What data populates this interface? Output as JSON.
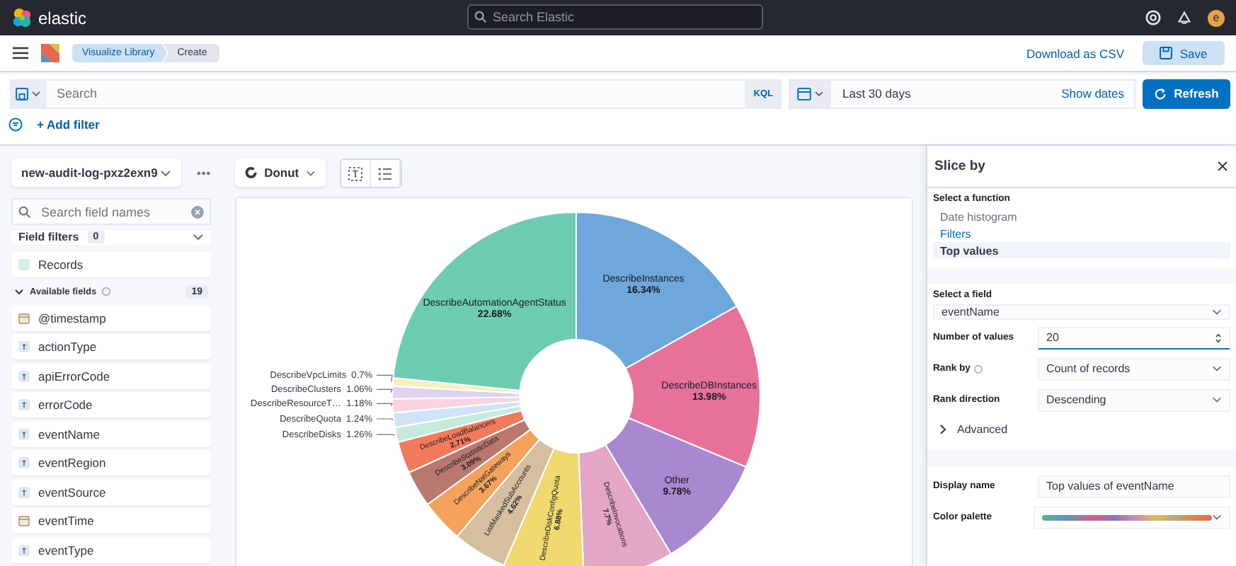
{
  "header": {
    "logo": "elastic",
    "search_placeholder": "Search Elastic",
    "avatar": "e"
  },
  "nav": {
    "breadcrumbs": [
      {
        "label": "Visualize Library",
        "selected": false
      },
      {
        "label": "Create",
        "selected": true
      }
    ],
    "download": "Download as CSV",
    "save": "Save"
  },
  "query_bar": {
    "placeholder": "Search",
    "language": "KQL",
    "date_range": "Last 30 days",
    "show_dates": "Show dates",
    "refresh": "Refresh"
  },
  "filter_bar": {
    "add_filter": "+ Add filter"
  },
  "sidebar": {
    "index_pattern": "new-audit-log-pxz2exn9",
    "search_placeholder": "Search field names",
    "field_filters": {
      "label": "Field filters",
      "count": "0"
    },
    "records": "Records",
    "available": {
      "label": "Available fields",
      "count": "19",
      "expanded": true
    },
    "fields": [
      {
        "name": "@timestamp",
        "kind": "date"
      },
      {
        "name": "actionType",
        "kind": "string"
      },
      {
        "name": "apiErrorCode",
        "kind": "string"
      },
      {
        "name": "errorCode",
        "kind": "string"
      },
      {
        "name": "eventName",
        "kind": "string"
      },
      {
        "name": "eventRegion",
        "kind": "string"
      },
      {
        "name": "eventSource",
        "kind": "string"
      },
      {
        "name": "eventTime",
        "kind": "date"
      },
      {
        "name": "eventType",
        "kind": "string"
      }
    ]
  },
  "workspace": {
    "chart_type": "Donut",
    "chart_data": {
      "type": "donut",
      "value_labels": [
        "16.34%",
        "13.98%",
        "9.78%",
        "7.7%",
        "6.88%",
        "4.62%",
        "3.67%",
        "3.09%",
        "2.71%",
        "1.26%",
        "1.24%",
        "1.18%",
        "1.06%",
        "0.7%",
        "22.68%"
      ],
      "categories": [
        "DescribeInstances",
        "DescribeDBInstances",
        "Other",
        "DescribeInvocations",
        "DescribeDiskConfigQuota",
        "ListMaskedSubAccounts",
        "DescribeNatGateways",
        "DescribeStatisticData",
        "DescribeLoadBalancers",
        "DescribeDisks",
        "DescribeQuota",
        "DescribeResourceT…",
        "DescribeClusters",
        "DescribeVpcLimits",
        "DescribeAutomationAgentStatus"
      ],
      "values": [
        16.34,
        13.98,
        9.78,
        7.7,
        6.88,
        4.62,
        3.67,
        3.09,
        2.71,
        1.26,
        1.24,
        1.18,
        1.06,
        0.7,
        22.68
      ]
    }
  },
  "panel": {
    "title": "Slice by",
    "function_label": "Select a function",
    "functions": [
      {
        "label": "Date histogram",
        "selected": false,
        "focused": false
      },
      {
        "label": "Filters",
        "selected": false,
        "focused": true
      },
      {
        "label": "Top values",
        "selected": true,
        "focused": false
      }
    ],
    "field_label": "Select a field",
    "field": "eventName",
    "rows": [
      {
        "label": "Number of values",
        "value": "20",
        "kind": "number",
        "info": false
      },
      {
        "label": "Rank by",
        "value": "Count of records",
        "kind": "select",
        "info": true
      },
      {
        "label": "Rank direction",
        "value": "Descending",
        "kind": "select",
        "info": false
      }
    ],
    "advanced": {
      "label": "Advanced",
      "expanded": false
    },
    "display_name": {
      "label": "Display name",
      "value": "Top values of eventName"
    },
    "color_palette": {
      "label": "Color palette"
    }
  }
}
